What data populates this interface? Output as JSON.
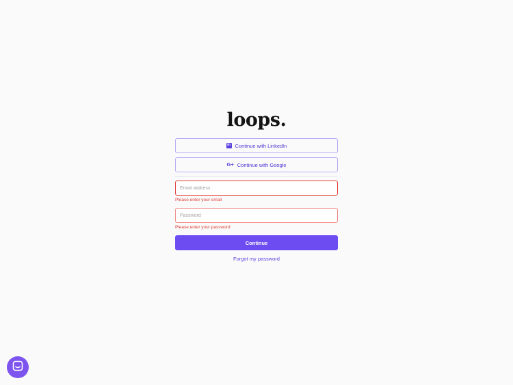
{
  "brand": {
    "logo_text": "loops.",
    "accent_color": "#6d4cf1",
    "error_color": "#e0403a"
  },
  "oauth": {
    "linkedin": {
      "label": "Continue with LinkedIn",
      "icon": "linkedin-icon",
      "glyph": "in"
    },
    "google": {
      "label": "Continue with Google",
      "icon": "google-plus-icon",
      "glyph": "G+"
    }
  },
  "form": {
    "email": {
      "placeholder": "Email address",
      "value": "",
      "error": "Please enter your email"
    },
    "password": {
      "placeholder": "Password",
      "value": "",
      "error": "Please enter your password"
    },
    "submit_label": "Continue",
    "forgot_label": "Forgot my password"
  },
  "chat": {
    "icon": "chat-icon"
  }
}
